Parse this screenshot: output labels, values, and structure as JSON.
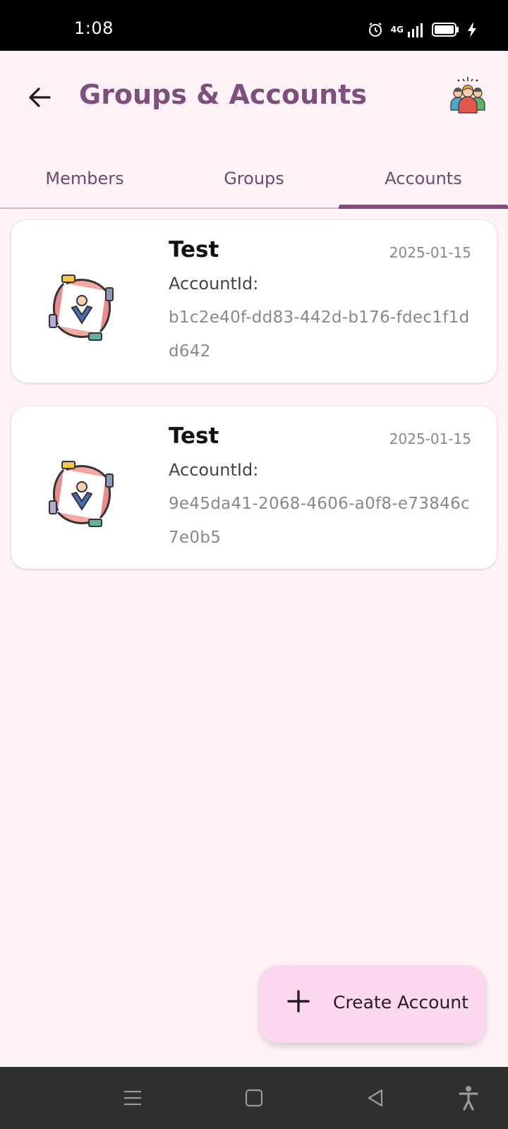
{
  "status_bar": {
    "time": "1:08",
    "network": "4G",
    "icons": [
      "alarm-icon",
      "signal-icon",
      "battery-icon",
      "charging-icon"
    ]
  },
  "header": {
    "title": "Groups & Accounts",
    "back_icon": "arrow-left-icon",
    "avatar_icon": "group-people-icon"
  },
  "tabs": [
    {
      "label": "Members",
      "selected": false
    },
    {
      "label": "Groups",
      "selected": false
    },
    {
      "label": "Accounts",
      "selected": true
    }
  ],
  "accounts": [
    {
      "name": "Test",
      "date": "2025-01-15",
      "id_label": "AccountId:",
      "id_value": "b1c2e40f-dd83-442d-b176-fdec1f1dd642",
      "icon": "team-hands-icon"
    },
    {
      "name": "Test",
      "date": "2025-01-15",
      "id_label": "AccountId:",
      "id_value": "9e45da41-2068-4606-a0f8-e73846c7e0b5",
      "icon": "team-hands-icon"
    }
  ],
  "fab": {
    "label": "Create Account",
    "icon": "plus-icon"
  },
  "nav_bar": {
    "icons": [
      "menu-icon",
      "home-icon",
      "back-icon",
      "accessibility-icon"
    ]
  },
  "colors": {
    "background": "#FFF3F8",
    "accent": "#7E4F7C",
    "fab": "#FCD7F0"
  }
}
